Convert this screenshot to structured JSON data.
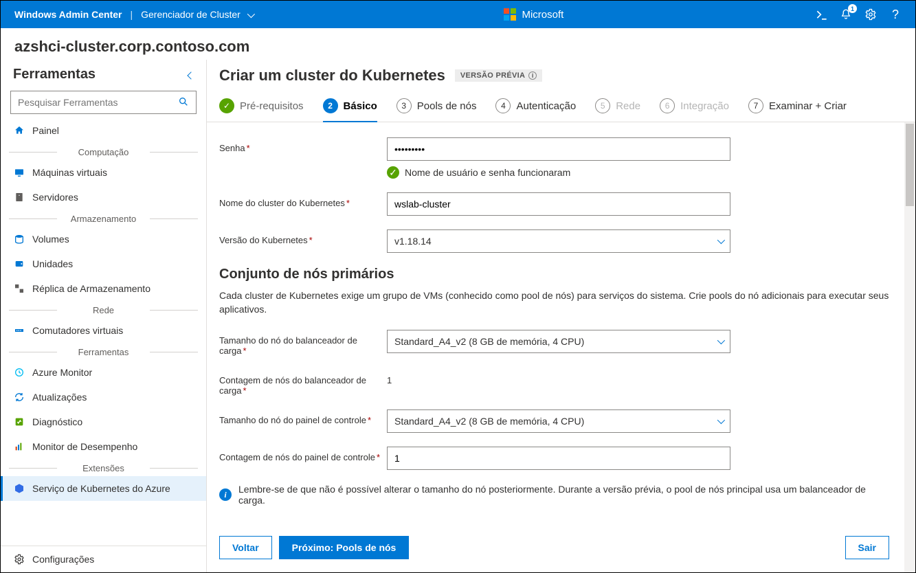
{
  "topbar": {
    "app_name": "Windows Admin Center",
    "crumb": "Gerenciador de Cluster",
    "brand_label": "Microsoft",
    "notification_count": "1"
  },
  "cluster_host": "azshci-cluster.corp.contoso.com",
  "sidebar": {
    "title": "Ferramentas",
    "search_placeholder": "Pesquisar Ferramentas",
    "groups": {
      "computacao": "Computação",
      "armazenamento": "Armazenamento",
      "rede": "Rede",
      "ferramentas": "Ferramentas",
      "extensoes": "Extensões"
    },
    "items": {
      "painel": "Painel",
      "maquinas": "Máquinas virtuais",
      "servidores": "Servidores",
      "volumes": "Volumes",
      "unidades": "Unidades",
      "replica": "Réplica de Armazenamento",
      "comutadores": "Comutadores virtuais",
      "azuremonitor": "Azure Monitor",
      "atualizacoes": "Atualizações",
      "diagnostico": "Diagnóstico",
      "monitordesempenho": "Monitor de Desempenho",
      "aks": "Serviço de Kubernetes do Azure"
    },
    "settings": "Configurações"
  },
  "page": {
    "title": "Criar um cluster do Kubernetes",
    "preview_tag": "VERSÃO PRÉVIA"
  },
  "steps": {
    "s1": "Pré-requisitos",
    "s2": "Básico",
    "s3": "Pools de nós",
    "s4": "Autenticação",
    "s5": "Rede",
    "s6": "Integração",
    "s7": "Examinar + Criar"
  },
  "form": {
    "senha_label": "Senha",
    "senha_value": "•••••••••",
    "senha_ok": "Nome de usuário e senha funcionaram",
    "clustername_label": "Nome do cluster do Kubernetes",
    "clustername_value": "wslab-cluster",
    "version_label": "Versão do Kubernetes",
    "version_value": "v1.18.14",
    "primary_heading": "Conjunto de nós primários",
    "primary_desc": "Cada cluster de Kubernetes exige um grupo de VMs (conhecido como pool de nós) para serviços do sistema. Crie pools do nó adicionais para executar seus aplicativos.",
    "lb_size_label": "Tamanho do nó do balanceador de carga",
    "lb_size_value": "Standard_A4_v2 (8 GB de memória, 4 CPU)",
    "lb_count_label": "Contagem de nós do balanceador de carga",
    "lb_count_value": "1",
    "cp_size_label": "Tamanho do nó do painel de controle",
    "cp_size_value": "Standard_A4_v2 (8 GB de memória, 4 CPU)",
    "cp_count_label": "Contagem de nós do painel de controle",
    "cp_count_value": "1",
    "info_msg": "Lembre-se de que não é possível alterar o tamanho do nó posteriormente. Durante a versão prévia, o pool de nós principal usa um balanceador de carga."
  },
  "buttons": {
    "back": "Voltar",
    "next": "Próximo: Pools de nós",
    "exit": "Sair"
  }
}
